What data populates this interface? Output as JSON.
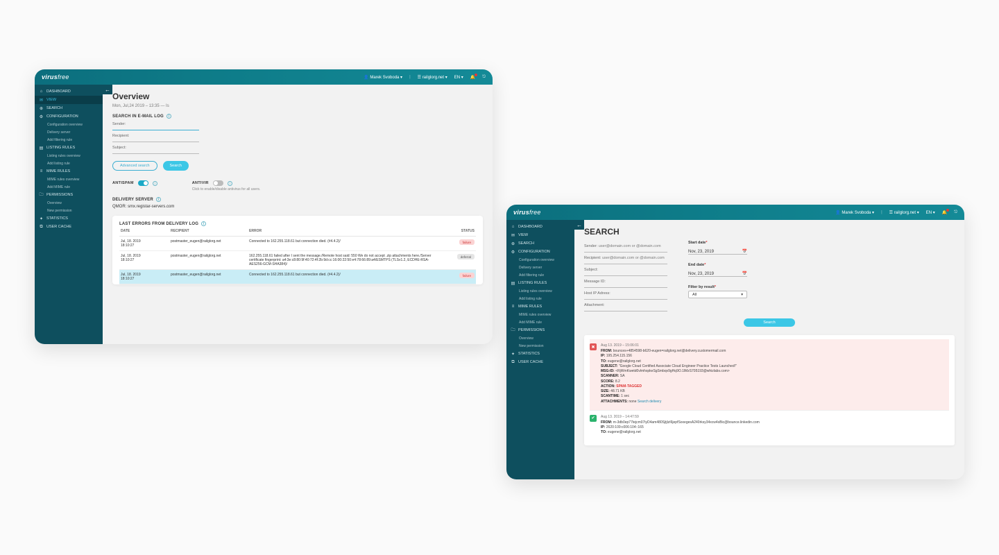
{
  "brand": {
    "name": "virus",
    "suffix": "free"
  },
  "topbar": {
    "user": "Marek Svoboda",
    "domain": "railglorg.net",
    "lang": "EN"
  },
  "sidebar": {
    "items": [
      {
        "icon": "⌂",
        "label": "DASHBOARD"
      },
      {
        "icon": "✉",
        "label": "VIEW"
      },
      {
        "icon": "⊕",
        "label": "SEARCH"
      },
      {
        "icon": "⚙",
        "label": "CONFIGURATION"
      },
      {
        "icon": "▤",
        "label": "LISTING RULES"
      },
      {
        "icon": "≡",
        "label": "MIME RULES"
      },
      {
        "icon": "🗀",
        "label": "PERMISSIONS"
      },
      {
        "icon": "✦",
        "label": "STATISTICS"
      },
      {
        "icon": "⧉",
        "label": "USER CACHE"
      }
    ],
    "config_subs": [
      "Configuration overview",
      "Delivery server",
      "Add filtering rule"
    ],
    "listing_subs": [
      "Listing rules overview",
      "Add listing rule"
    ],
    "mime_subs": [
      "MIME rules overview",
      "Add MIME rule"
    ],
    "perm_subs": [
      "Overview",
      "New permission"
    ]
  },
  "overview": {
    "title": "Overview",
    "timestamp": "Mon, Jul,24  2019 – 13:35 — Is",
    "search_section": "SEARCH IN E-MAIL LOG",
    "labels": {
      "sender": "Sender:",
      "recipient": "Recipient:",
      "subject": "Subject:"
    },
    "buttons": {
      "advanced": "Advanced search",
      "search": "Search"
    },
    "antispam_label": "ANTISPAM",
    "antivir_label": "ANTIVIR",
    "antivir_desc": "Click to enable/disable antivirus for all users.",
    "delivery_section": "DELIVERY SERVER",
    "delivery_value": "QMOR: smx.registar-servers.com",
    "errors_section": "LAST ERRORS FROM DELIVERY LOG",
    "cols": {
      "date": "DATE",
      "recipient": "RECIPIENT",
      "error": "ERROR",
      "status": "STATUS"
    },
    "rows": [
      {
        "date": "Jul, 18. 2019",
        "time": "18:10:27",
        "recipient": "postmaster_eugen@railglorg.net",
        "error": "Connected to 162.255.118.61 but connection died. (#4.4.2)/",
        "status": "failure",
        "badge": "fail"
      },
      {
        "date": "Jul, 18. 2019",
        "time": "18:10:27",
        "recipient": "postmaster_eugen@railglorg.net",
        "error": "162.255.118.61 failed after I sent the message./Remote host said: 550 We do not accept .zip attachments here./Server certificate fingerprint: a4:3e:c8:80:9f:40:72:4f:2b:9d:cc:16:00:22:50:e4:78:66:89:a4/ESMTPS (TLSv1.2, ECDHE-RSA-AES256-GCM-SHA384)/",
        "status": "deferral",
        "badge": "def"
      },
      {
        "date": "Jul, 18. 2019",
        "time": "18:10:27",
        "recipient": "postmaster_eugen@railglorg.net",
        "error": "Connected to 162.255.118.61 but connection died. (#4.4.2)/",
        "status": "failure",
        "badge": "fail",
        "selected": true
      }
    ]
  },
  "search": {
    "title": "SEARCH",
    "labels": {
      "sender": "Sender:",
      "recipient": "Recipient:",
      "subject": "Subject:",
      "message_id": "Message ID:",
      "host_ip": "Host IP Adress:",
      "attachment": "Attachment:"
    },
    "placeholder": "user@domain.com or @domain.com",
    "start_label": "Start date",
    "end_label": "End date",
    "start_value": "Nov, 23, 2019",
    "end_value": "Nov, 23, 2019",
    "filter_label": "Filter by result",
    "filter_value": "All",
    "button": "Search",
    "results": [
      {
        "kind": "spam",
        "time": "Aug 13. 2019 – 15:06:01",
        "from": "bounces+4854598-b620-eugen=railglorg.net@delivery.customermail.com",
        "ip": "195.254.115.156",
        "to": "eugene@railglorg.net",
        "subject": "\"Google Cloud Certified Associate Cloud Engineer Practice Tests Launched!\"",
        "msgid": "<RjWmKwetd0vlmhxpkeSgSmbqv9gHq9O.1lMzS705193@whizlabs.com>",
        "scanner": "SA",
        "score": "8.2",
        "action": "SPAM-TAGGED",
        "size": "48.71 KB",
        "scantime": "1 sec",
        "attachments_prefix": "none",
        "attachments_link": "Search delivery"
      },
      {
        "kind": "ok",
        "time": "Aug 13. 2019 – 14:47:59",
        "from": "m-3db0ep77tejcm07iyD4am480SjtjlzI6jepfSoxegesA240rksy34xcw4sBic@bounce.linkedin.com",
        "ip": "2620:109:c006:104::165",
        "to": "eugene@railglorg.net"
      }
    ]
  }
}
